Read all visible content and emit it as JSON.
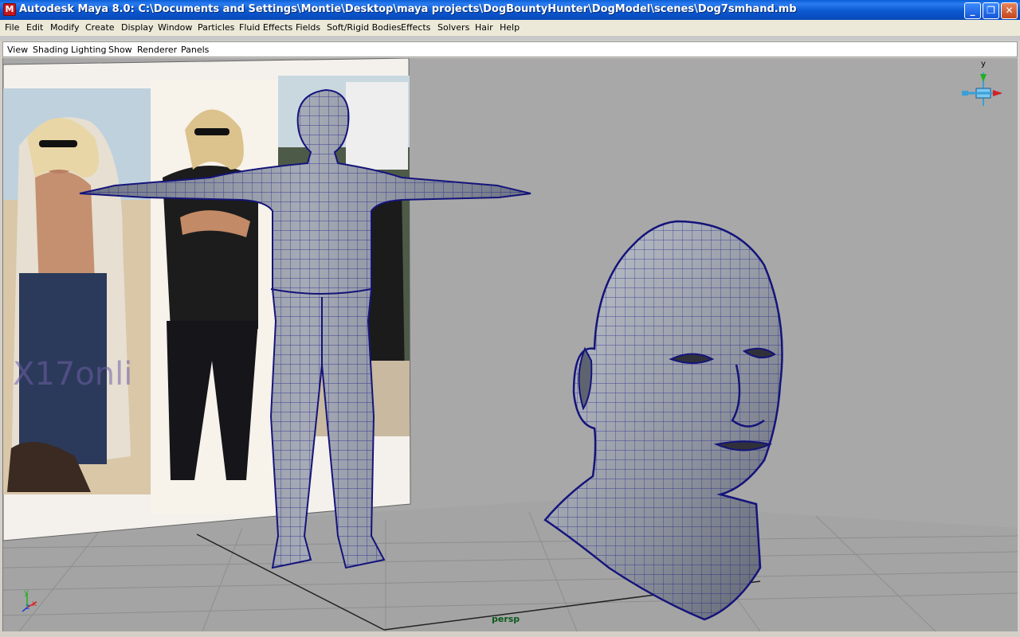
{
  "window": {
    "icon_letter": "M",
    "title": "Autodesk Maya 8.0: C:\\Documents and Settings\\Montie\\Desktop\\maya projects\\DogBountyHunter\\DogModel\\scenes\\Dog7smhand.mb",
    "minimize_glyph": "_",
    "maximize_glyph": "❐",
    "close_glyph": "✕"
  },
  "menubar": [
    "File",
    "Edit",
    "Modify",
    "Create",
    "Display",
    "Window",
    "Particles",
    "Fluid Effects",
    "Fields",
    "Soft/Rigid Bodies",
    "Effects",
    "Solvers",
    "Hair",
    "Help"
  ],
  "panel_menu": [
    "View",
    "Shading",
    "Lighting",
    "Show",
    "Renderer",
    "Panels"
  ],
  "viewport": {
    "camera_label": "persp",
    "watermark": "X17onli",
    "view_cube_axis": "y",
    "axis_labels": {
      "y": "y",
      "z": "z",
      "x": "x"
    }
  },
  "colors": {
    "viewport_bg": "#a8a8a8",
    "wire": "#1a1a8c",
    "mesh_fill": "#8a8f9a",
    "title_bar": "#0b58d0"
  }
}
